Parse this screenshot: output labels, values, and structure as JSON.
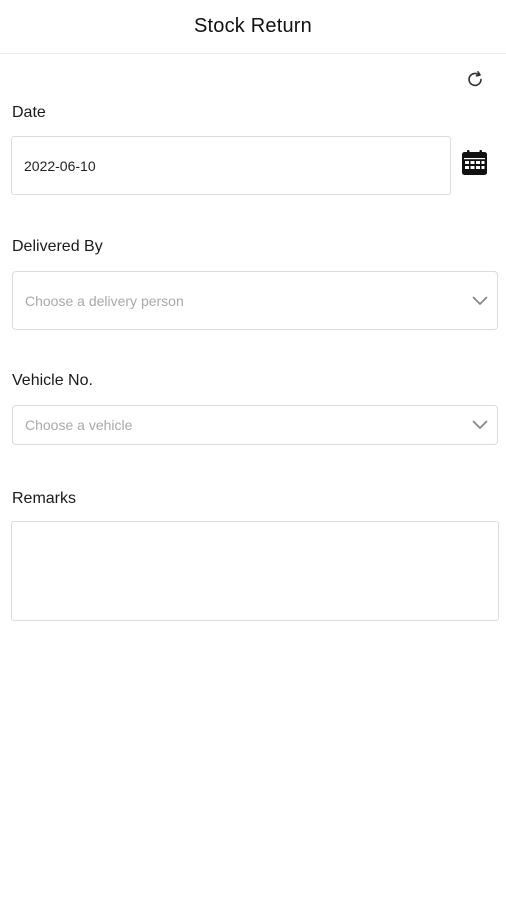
{
  "header": {
    "title": "Stock Return"
  },
  "icons": {
    "refresh": "refresh-icon",
    "calendar": "calendar-icon",
    "chevron": "chevron-down-icon"
  },
  "form": {
    "date": {
      "label": "Date",
      "value": "2022-06-10"
    },
    "delivered_by": {
      "label": "Delivered By",
      "placeholder": "Choose a delivery person"
    },
    "vehicle": {
      "label": "Vehicle No.",
      "placeholder": "Choose a vehicle"
    },
    "remarks": {
      "label": "Remarks",
      "value": ""
    }
  }
}
